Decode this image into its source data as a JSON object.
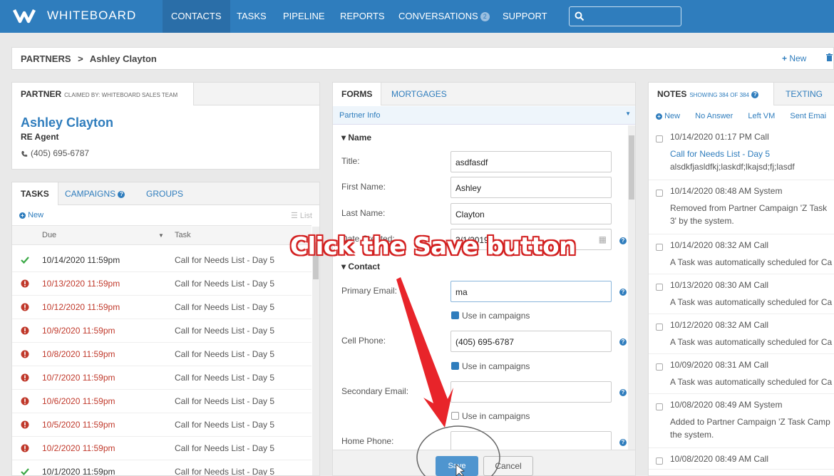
{
  "nav": {
    "brand": "WHITEBOARD",
    "items": [
      "CONTACTS",
      "TASKS",
      "PIPELINE",
      "REPORTS",
      "CONVERSATIONS",
      "SUPPORT"
    ],
    "conversations_badge": "2",
    "search_placeholder": ""
  },
  "breadcrumb": {
    "parent": "PARTNERS",
    "separator": ">",
    "current": "Ashley Clayton",
    "new_label": "New"
  },
  "partner": {
    "tab_label": "PARTNER",
    "claimed_by": "CLAIMED BY: WHITEBOARD SALES TEAM",
    "name": "Ashley Clayton",
    "role": "RE Agent",
    "phone": "(405) 695-6787"
  },
  "tasks_panel": {
    "tabs": [
      "TASKS",
      "CAMPAIGNS",
      "GROUPS"
    ],
    "new_label": "New",
    "list_label": "List",
    "col_due": "Due",
    "col_task": "Task",
    "rows": [
      {
        "due": "10/14/2020 11:59pm",
        "task": "Call for Needs List - Day 5",
        "status": "done"
      },
      {
        "due": "10/13/2020 11:59pm",
        "task": "Call for Needs List - Day 5",
        "status": "overdue"
      },
      {
        "due": "10/12/2020 11:59pm",
        "task": "Call for Needs List - Day 5",
        "status": "overdue"
      },
      {
        "due": "10/9/2020 11:59pm",
        "task": "Call for Needs List - Day 5",
        "status": "overdue"
      },
      {
        "due": "10/8/2020 11:59pm",
        "task": "Call for Needs List - Day 5",
        "status": "overdue"
      },
      {
        "due": "10/7/2020 11:59pm",
        "task": "Call for Needs List - Day 5",
        "status": "overdue"
      },
      {
        "due": "10/6/2020 11:59pm",
        "task": "Call for Needs List - Day 5",
        "status": "overdue"
      },
      {
        "due": "10/5/2020 11:59pm",
        "task": "Call for Needs List - Day 5",
        "status": "overdue"
      },
      {
        "due": "10/2/2020 11:59pm",
        "task": "Call for Needs List - Day 5",
        "status": "overdue"
      },
      {
        "due": "10/1/2020 11:59pm",
        "task": "Call for Needs List - Day 5",
        "status": "done"
      }
    ]
  },
  "forms_panel": {
    "tabs": [
      "FORMS",
      "MORTGAGES"
    ],
    "section_select": "Partner Info",
    "name_section": "Name",
    "contact_section": "Contact",
    "fields": {
      "title_label": "Title:",
      "title_value": "asdfasdf",
      "first_label": "First Name:",
      "first_value": "Ashley",
      "last_label": "Last Name:",
      "last_value": "Clayton",
      "created_label": "Date Created:",
      "created_value": "3/1/2019",
      "primary_email_label": "Primary Email:",
      "primary_email_value": "ma",
      "cell_label": "Cell Phone:",
      "cell_value": "(405) 695-6787",
      "secondary_email_label": "Secondary Email:",
      "secondary_email_value": "",
      "home_label": "Home Phone:",
      "home_value": ""
    },
    "use_in_campaigns": "Use in campaigns",
    "save_label": "Save",
    "cancel_label": "Cancel"
  },
  "notes_panel": {
    "title": "NOTES",
    "showing": "SHOWING 384 OF 384",
    "texting_tab": "TEXTING",
    "actions": [
      "New",
      "No Answer",
      "Left VM",
      "Sent Emai"
    ],
    "notes": [
      {
        "meta": "10/14/2020 01:17 PM  Call",
        "lines": [
          "Call for Needs List - Day 5",
          "alsdkfjasldfkj;laskdf;lkajsd;fj;lasdf"
        ],
        "first_link": true
      },
      {
        "meta": "10/14/2020 08:48 AM  System",
        "lines": [
          "Removed from Partner Campaign 'Z Task",
          "3' by the system."
        ],
        "first_link": false
      },
      {
        "meta": "10/14/2020 08:32 AM  Call",
        "lines": [
          "A Task was automatically scheduled for Ca"
        ],
        "first_link": false
      },
      {
        "meta": "10/13/2020 08:30 AM  Call",
        "lines": [
          "A Task was automatically scheduled for Ca"
        ],
        "first_link": false
      },
      {
        "meta": "10/12/2020 08:32 AM  Call",
        "lines": [
          "A Task was automatically scheduled for Ca"
        ],
        "first_link": false
      },
      {
        "meta": "10/09/2020 08:31 AM  Call",
        "lines": [
          "A Task was automatically scheduled for Ca"
        ],
        "first_link": false
      },
      {
        "meta": "10/08/2020 08:49 AM  System",
        "lines": [
          "Added to Partner Campaign 'Z Task Camp",
          "the system."
        ],
        "first_link": false
      },
      {
        "meta": "10/08/2020 08:49 AM  Call",
        "lines": [],
        "first_link": false
      }
    ]
  },
  "annotation": {
    "callout": "Click the Save button",
    "color": "#e8242a"
  },
  "colors": {
    "primary": "#2f7dbd",
    "overdue": "#c0392b",
    "done": "#3aa845"
  }
}
